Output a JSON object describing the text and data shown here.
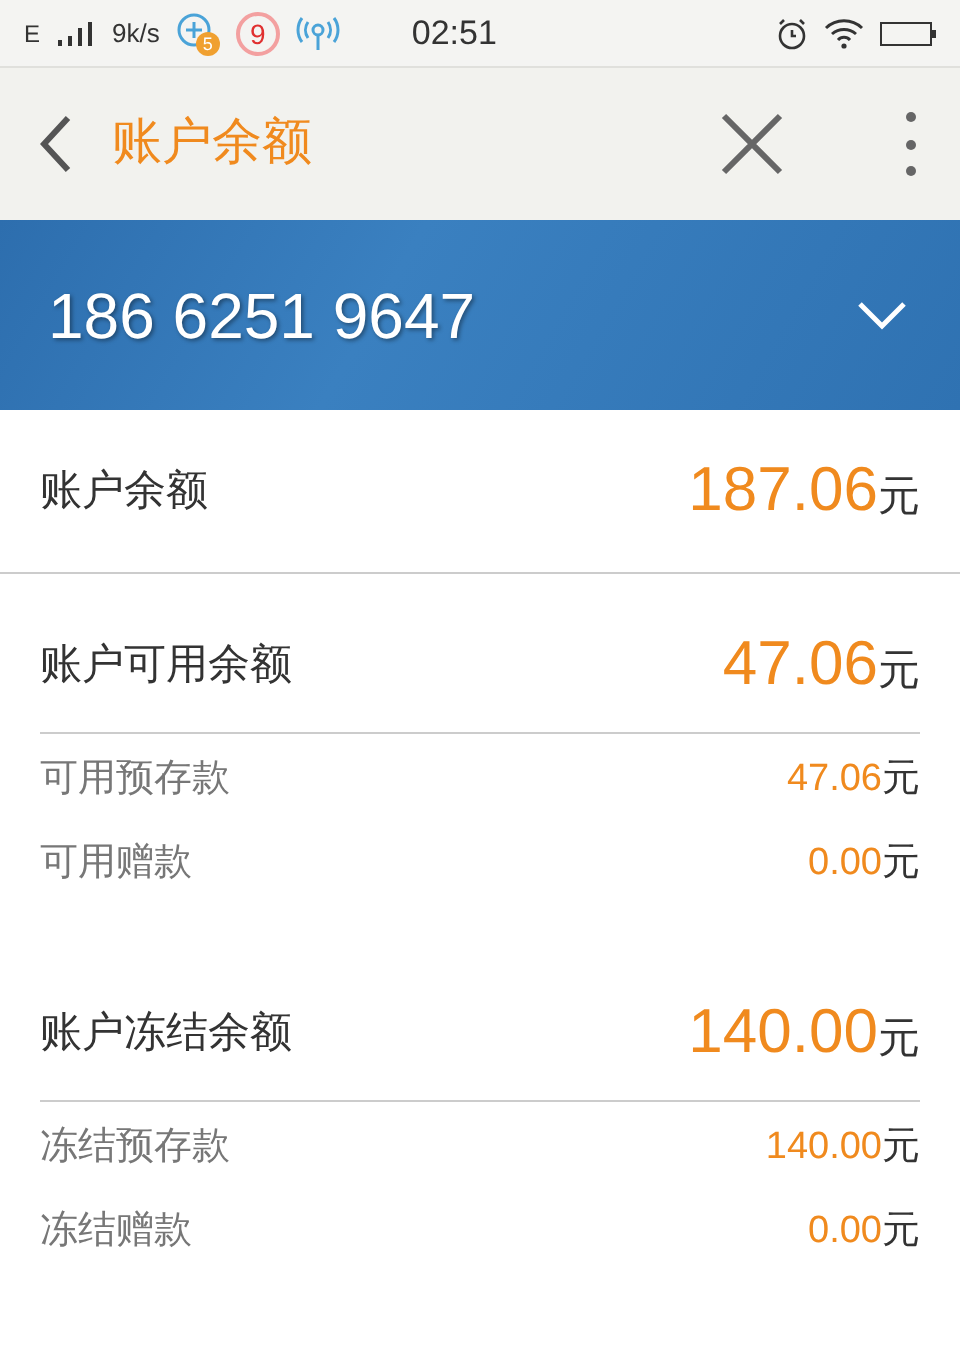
{
  "status_bar": {
    "network": "E",
    "speed": "9k/s",
    "badge_count": "5",
    "notification_count": "9",
    "time": "02:51"
  },
  "header": {
    "title": "账户余额"
  },
  "account": {
    "number": "186 6251 9647"
  },
  "total": {
    "label": "账户余额",
    "amount": "187.06",
    "unit": "元"
  },
  "sections": [
    {
      "label": "账户可用余额",
      "amount": "47.06",
      "unit": "元",
      "items": [
        {
          "label": "可用预存款",
          "amount": "47.06",
          "unit": "元"
        },
        {
          "label": "可用赠款",
          "amount": "0.00",
          "unit": "元"
        }
      ]
    },
    {
      "label": "账户冻结余额",
      "amount": "140.00",
      "unit": "元",
      "items": [
        {
          "label": "冻结预存款",
          "amount": "140.00",
          "unit": "元"
        },
        {
          "label": "冻结赠款",
          "amount": "0.00",
          "unit": "元"
        }
      ]
    }
  ]
}
